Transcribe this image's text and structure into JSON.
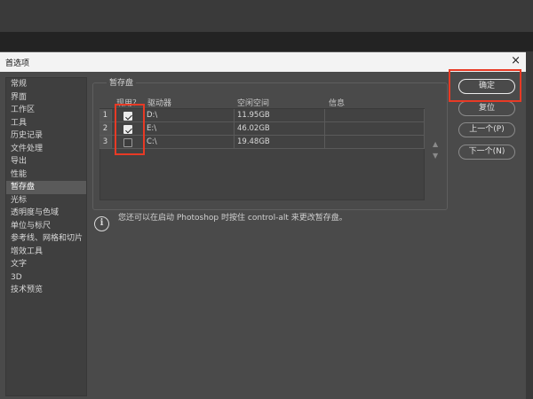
{
  "dialog": {
    "title": "首选项",
    "close_glyph": "×"
  },
  "sidebar": {
    "items": [
      "常规",
      "界面",
      "工作区",
      "工具",
      "历史记录",
      "文件处理",
      "导出",
      "性能",
      "暂存盘",
      "光标",
      "透明度与色域",
      "单位与标尺",
      "参考线、网格和切片",
      "增效工具",
      "文字",
      "3D",
      "技术预览"
    ],
    "selected_index": 8
  },
  "scratch": {
    "group_title": "暂存盘",
    "headers": {
      "use": "现用？",
      "drive": "驱动器",
      "free": "空闲空间",
      "info": "信息"
    },
    "rows": [
      {
        "num": "1",
        "checked": true,
        "drive": "D:\\",
        "free": "11.95GB",
        "info": ""
      },
      {
        "num": "2",
        "checked": true,
        "drive": "E:\\",
        "free": "46.02GB",
        "info": ""
      },
      {
        "num": "3",
        "checked": false,
        "drive": "C:\\",
        "free": "19.48GB",
        "info": ""
      }
    ],
    "move_up_glyph": "▲",
    "move_down_glyph": "▼"
  },
  "info": {
    "icon_glyph": "i",
    "text": "您还可以在启动 Photoshop 时按住 control-alt 来更改暂存盘。"
  },
  "buttons": {
    "ok": "确定",
    "reset": "复位",
    "prev": "上一个(P)",
    "next": "下一个(N)"
  },
  "colors": {
    "highlight": "#e83a25",
    "dialog_bg": "#4a4a4a",
    "sidebar_selected": "#5a5a5a"
  }
}
